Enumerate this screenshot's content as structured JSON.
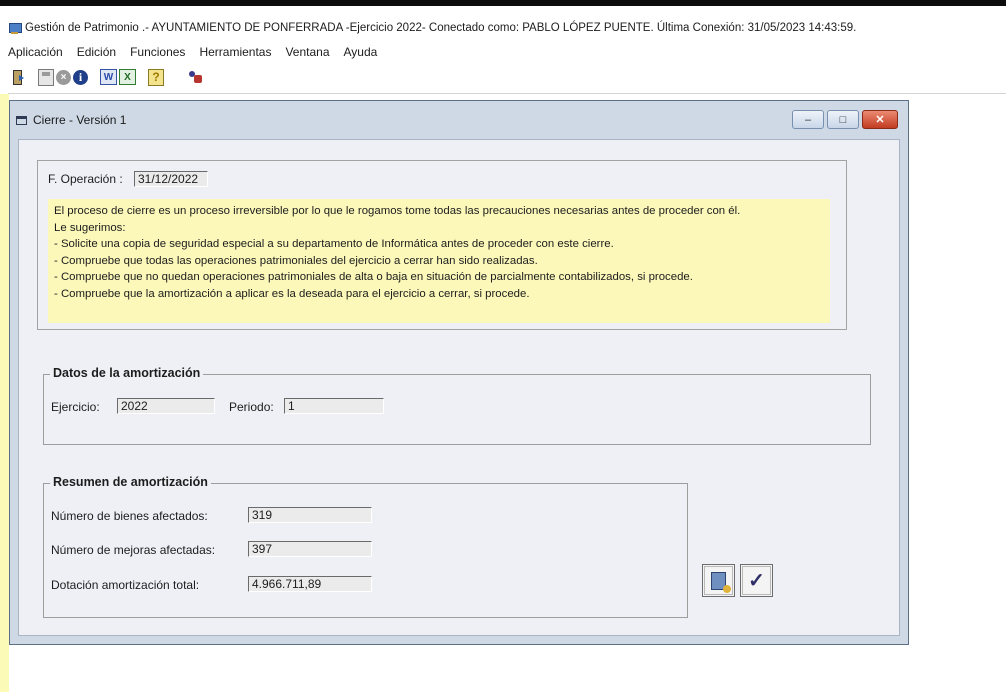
{
  "app": {
    "title": "Gestión de Patrimonio .- AYUNTAMIENTO DE PONFERRADA -Ejercicio 2022- Conectado como: PABLO LÓPEZ PUENTE. Última Conexión: 31/05/2023 14:43:59."
  },
  "menu": [
    "Aplicación",
    "Edición",
    "Funciones",
    "Herramientas",
    "Ventana",
    "Ayuda"
  ],
  "toolbar": {
    "icons": [
      "exit-icon",
      "save-icon",
      "cancel-icon",
      "info-icon",
      "word-icon",
      "excel-icon",
      "help-icon",
      "users-icon"
    ],
    "word_glyph": "W",
    "excel_glyph": "X",
    "help_glyph": "?",
    "info_glyph": "i",
    "cancel_glyph": "×"
  },
  "window": {
    "title": "Cierre - Versión 1",
    "minimize": "–",
    "maximize": "□",
    "close": "✕"
  },
  "operation": {
    "label": "F. Operación :",
    "value": "31/12/2022"
  },
  "notice": {
    "lines": [
      "El proceso de cierre es un proceso irreversible por lo que le rogamos tome todas las precauciones necesarias antes de proceder con él.",
      "Le sugerimos:",
      "- Solicite una copia de seguridad especial a  su departamento de Informática antes de proceder con este cierre.",
      "- Compruebe que todas las operaciones patrimoniales del ejercicio a cerrar han sido realizadas.",
      "- Compruebe que no quedan operaciones patrimoniales de alta o baja en situación de parcialmente contabilizados, si procede.",
      "- Compruebe que la amortización a aplicar es la deseada para el ejercicio a cerrar, si procede."
    ]
  },
  "amortizacion": {
    "title": "Datos de la amortización",
    "ejercicio_label": "Ejercicio:",
    "ejercicio_value": "2022",
    "periodo_label": "Periodo:",
    "periodo_value": "1"
  },
  "resumen": {
    "title": "Resumen de amortización",
    "bienes_label": "Número de bienes afectados:",
    "bienes_value": "319",
    "mejoras_label": "Número de mejoras afectadas:",
    "mejoras_value": "397",
    "dotacion_label": "Dotación amortización total:",
    "dotacion_value": "4.966.711,89"
  },
  "buttons": {
    "calculate_icon": "calculator-icon",
    "accept_icon": "checkmark-icon",
    "accept_glyph": "✓"
  },
  "colors": {
    "notice_bg": "#fbf8b9",
    "mdi_bg": "#fbfbb7",
    "window_frame": "#cfd9e6",
    "close_button": "#c23d22"
  }
}
